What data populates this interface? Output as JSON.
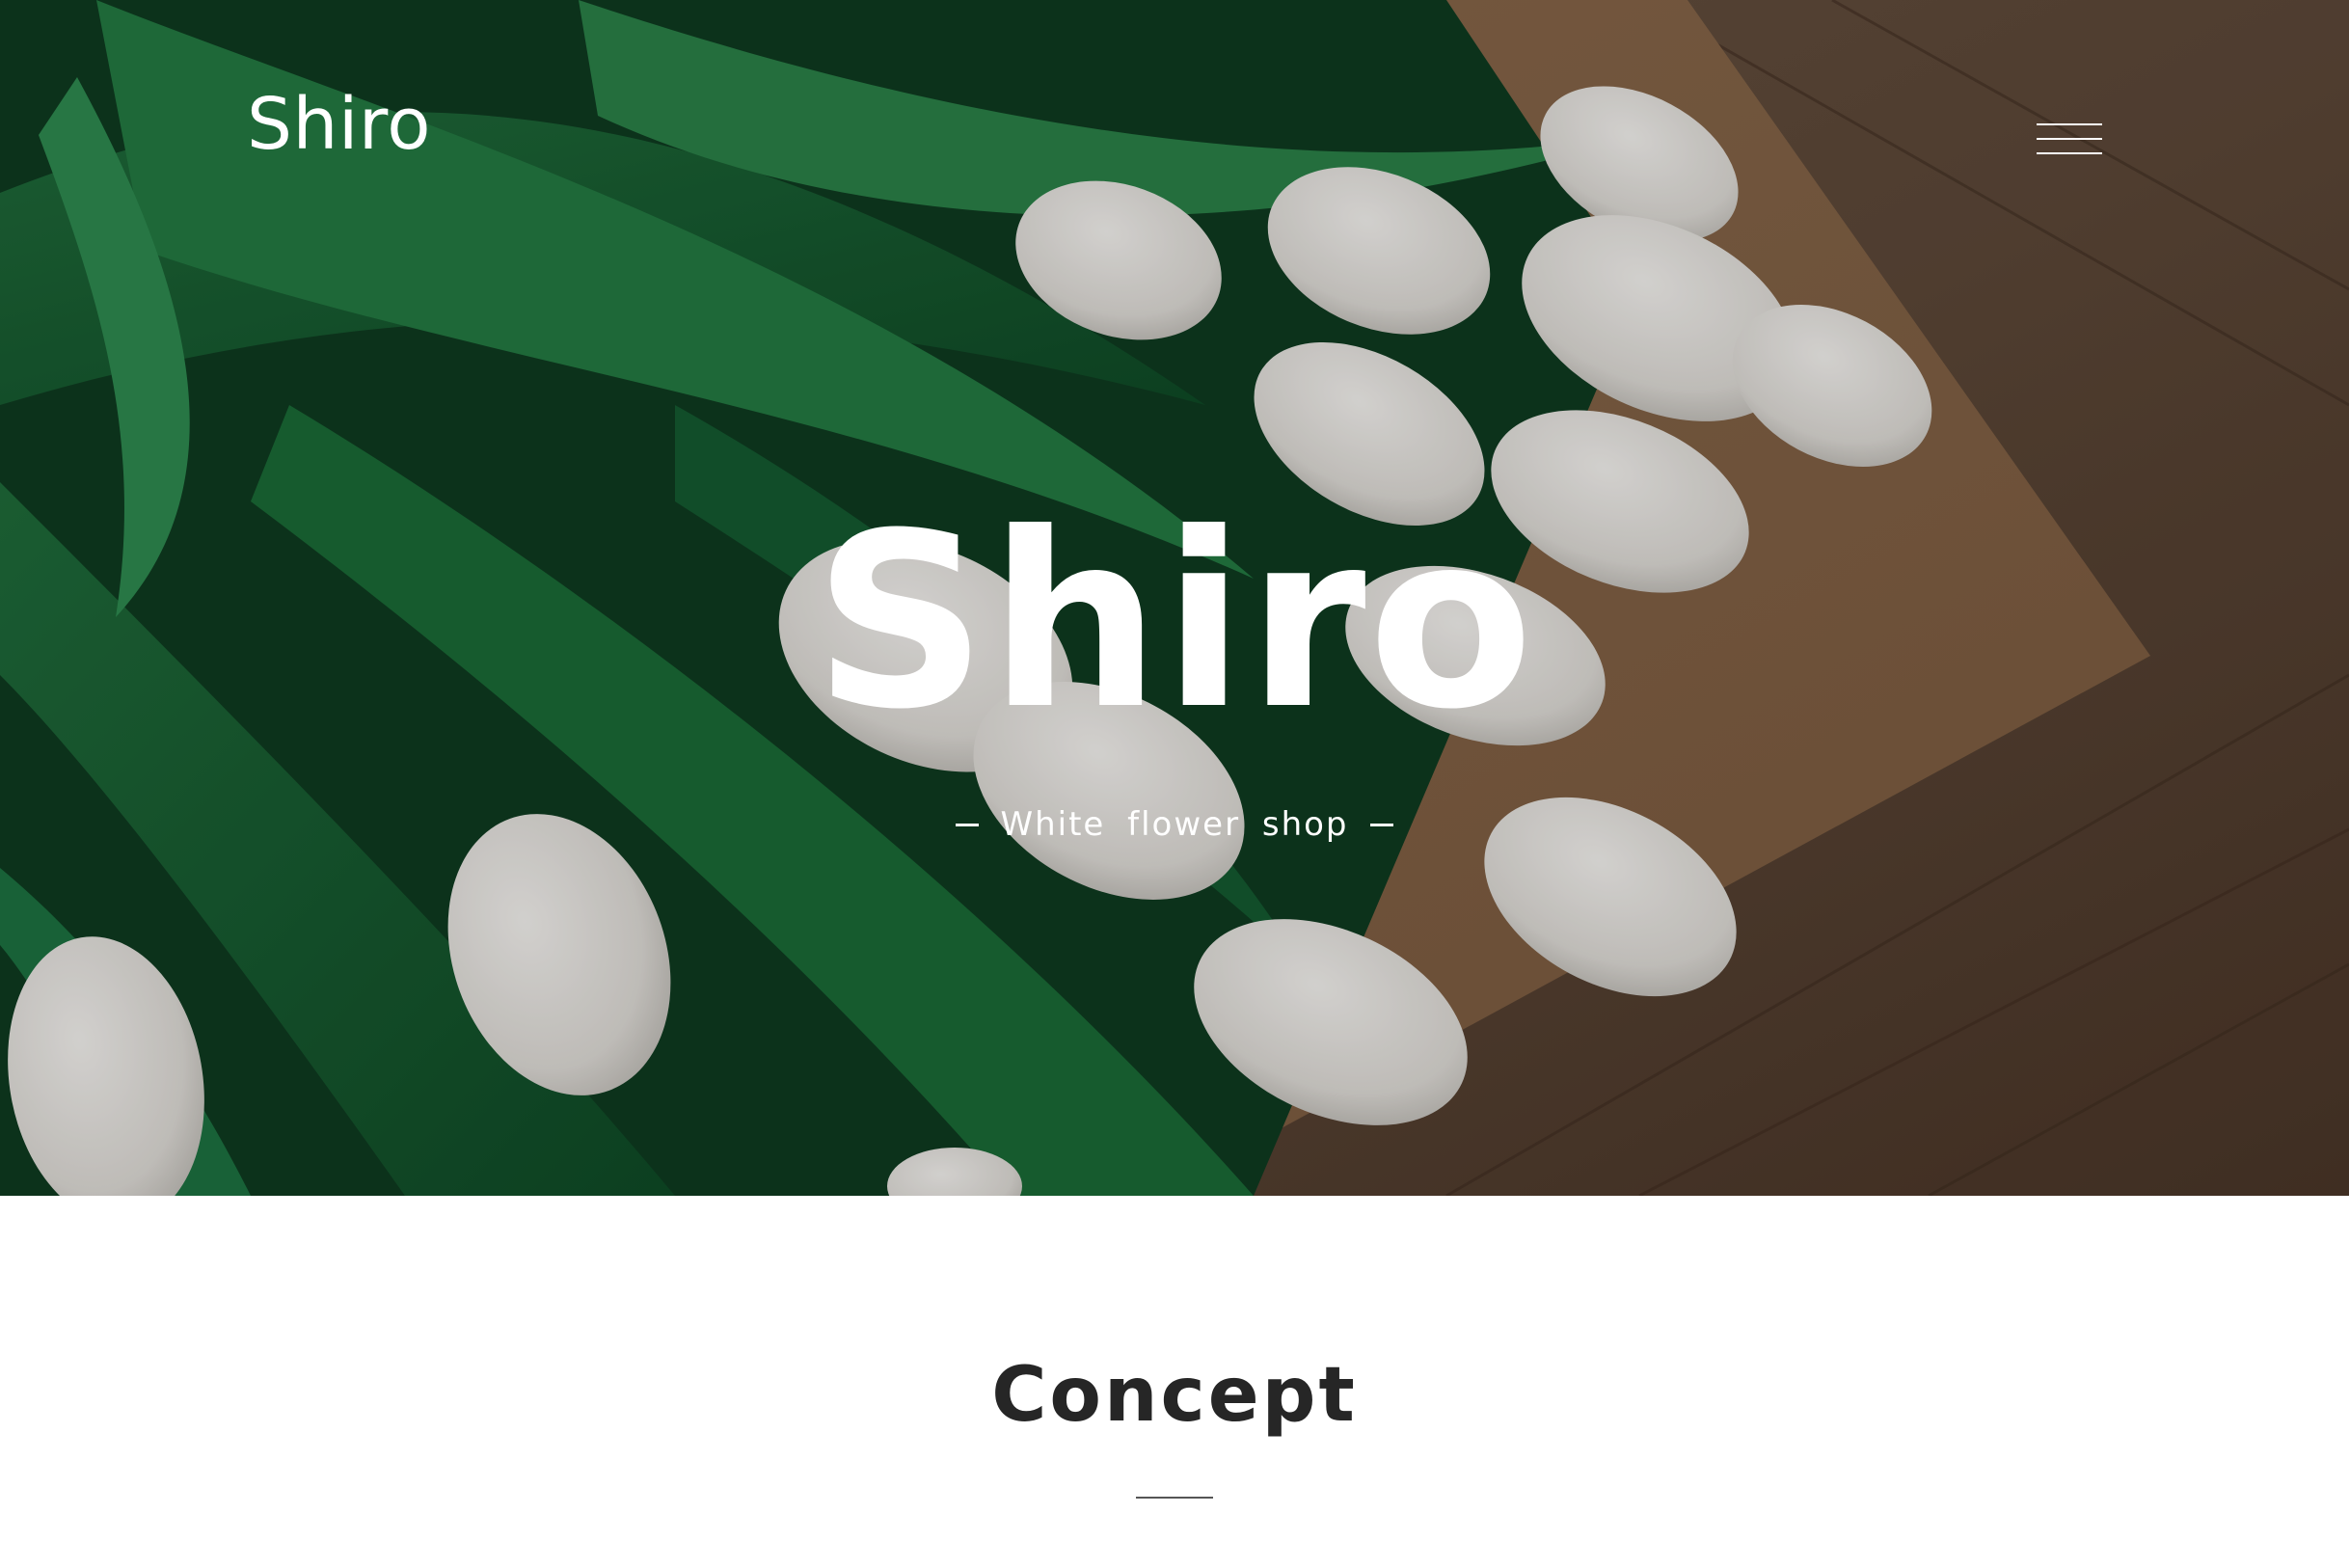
{
  "header": {
    "logo": "Shiro",
    "menu_icon": "hamburger-icon"
  },
  "hero": {
    "title": "Shiro",
    "subtitle": "White flower shop",
    "image": "white-tulip-bouquet-photo"
  },
  "concept": {
    "title": "Concept"
  },
  "colors": {
    "text_light": "#ffffff",
    "text_dark": "#262626",
    "background": "#ffffff"
  }
}
